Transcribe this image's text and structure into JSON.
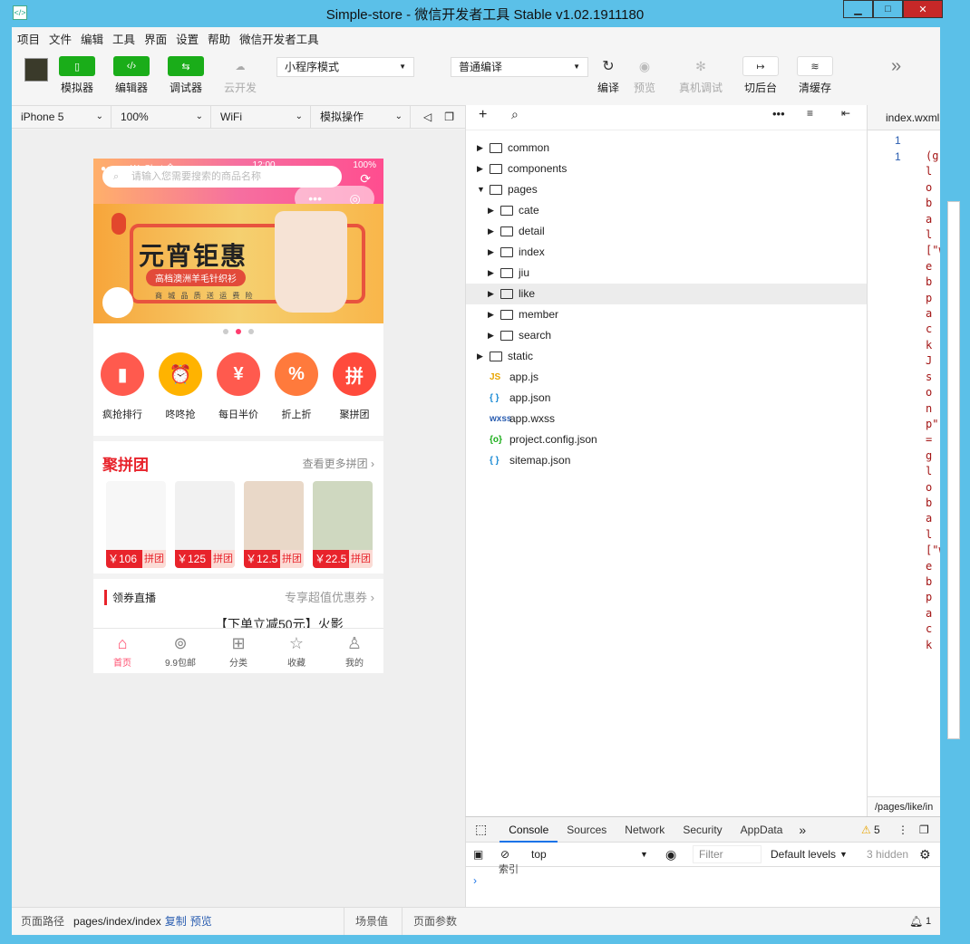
{
  "window": {
    "title": "Simple-store - 微信开发者工具 Stable v1.02.1911180",
    "icon": "devtools-logo-icon",
    "min": "▁",
    "max": "□",
    "close": "✕"
  },
  "menu": [
    "项目",
    "文件",
    "编辑",
    "工具",
    "界面",
    "设置",
    "帮助",
    "微信开发者工具"
  ],
  "toolbar": {
    "simulator": "模拟器",
    "editor": "编辑器",
    "debugger": "调试器",
    "cloud": "云开发",
    "mode": "小程序模式",
    "compile_mode": "普通编译",
    "compile": "编译",
    "preview": "预览",
    "real_debug": "真机调试",
    "background": "切后台",
    "clear_cache": "清缓存",
    "more": "»"
  },
  "subbar": {
    "device": "iPhone 5",
    "zoom": "100%",
    "network": "WiFi",
    "operation": "模拟操作"
  },
  "phone": {
    "status_left": "●●●●● WeChat 令",
    "status_time": "12:00",
    "status_right": "100%",
    "search_placeholder": "请输入您需要搜索的商品名称",
    "banner_title": "元宵钜惠",
    "banner_sub": "高档澳洲羊毛针织衫",
    "banner_sub2": "商 城 品 质   送 运 费 险",
    "categories": [
      {
        "name": "疯抢排行",
        "color": "#ff5a4e",
        "icon": "bar-chart-icon",
        "glyph": "▮"
      },
      {
        "name": "咚咚抢",
        "color": "#ffb300",
        "icon": "alarm-clock-icon",
        "glyph": "⏰"
      },
      {
        "name": "每日半价",
        "color": "#ff5a4e",
        "icon": "calendar-icon",
        "glyph": "¥"
      },
      {
        "name": "折上折",
        "color": "#ff7a3c",
        "icon": "discount-tag-icon",
        "glyph": "%"
      },
      {
        "name": "聚拼团",
        "color": "#ff4a3c",
        "icon": "group-buy-icon",
        "glyph": "拼"
      }
    ],
    "group": {
      "title": "聚拼团",
      "more": "查看更多拼团 ›",
      "items": [
        {
          "price": "￥106",
          "tag": "拼团",
          "color": "#f7f7f7"
        },
        {
          "price": "￥125",
          "tag": "拼团",
          "color": "#f1f1f1"
        },
        {
          "price": "￥12.5",
          "tag": "拼团",
          "color": "#e9d8c8"
        },
        {
          "price": "￥22.5",
          "tag": "拼团",
          "color": "#cfd8c0"
        }
      ]
    },
    "coupon": {
      "title": "领券直播",
      "more": "专享超值优惠券 ›",
      "ad": "【下单立减50元】火影"
    },
    "tabs": [
      {
        "label": "首页",
        "icon": "home-icon",
        "glyph": "⌂",
        "active": true
      },
      {
        "label": "9.9包邮",
        "icon": "coin-icon",
        "glyph": "⊚",
        "active": false
      },
      {
        "label": "分类",
        "icon": "category-grid-icon",
        "glyph": "⊞",
        "active": false
      },
      {
        "label": "收藏",
        "icon": "star-icon",
        "glyph": "☆",
        "active": false
      },
      {
        "label": "我的",
        "icon": "user-icon",
        "glyph": "♙",
        "active": false
      }
    ]
  },
  "tree": [
    {
      "type": "folder",
      "name": "common",
      "depth": 0,
      "open": false
    },
    {
      "type": "folder",
      "name": "components",
      "depth": 0,
      "open": false
    },
    {
      "type": "folder",
      "name": "pages",
      "depth": 0,
      "open": true
    },
    {
      "type": "folder",
      "name": "cate",
      "depth": 1,
      "open": false
    },
    {
      "type": "folder",
      "name": "detail",
      "depth": 1,
      "open": false
    },
    {
      "type": "folder",
      "name": "index",
      "depth": 1,
      "open": false
    },
    {
      "type": "folder",
      "name": "jiu",
      "depth": 1,
      "open": false
    },
    {
      "type": "folder",
      "name": "like",
      "depth": 1,
      "open": false,
      "selected": true
    },
    {
      "type": "folder",
      "name": "member",
      "depth": 1,
      "open": false
    },
    {
      "type": "folder",
      "name": "search",
      "depth": 1,
      "open": false
    },
    {
      "type": "folder",
      "name": "static",
      "depth": 0,
      "open": false
    },
    {
      "type": "file",
      "name": "app.js",
      "badge": "JS",
      "color": "#e8a400"
    },
    {
      "type": "file",
      "name": "app.json",
      "badge": "{ }",
      "color": "#1a8ad4"
    },
    {
      "type": "file",
      "name": "app.wxss",
      "badge": "wxss",
      "color": "#2a5db0"
    },
    {
      "type": "file",
      "name": "project.config.json",
      "badge": "{o}",
      "color": "#1aad19"
    },
    {
      "type": "file",
      "name": "sitemap.json",
      "badge": "{ }",
      "color": "#1a8ad4"
    }
  ],
  "editor": {
    "tab": "index.wxml",
    "line1": "1",
    "line2": "1",
    "code": "(global[\"webpackJsonp\"]=global[\"webpack",
    "path": "/pages/like/in"
  },
  "devtools": {
    "tabs": [
      "Console",
      "Sources",
      "Network",
      "Security",
      "AppData"
    ],
    "more": "»",
    "warnings": "5",
    "context": "top",
    "filter_placeholder": "Filter",
    "levels": "Default levels",
    "hidden": "3 hidden",
    "prompt": "›",
    "log_partial": "索引"
  },
  "status": {
    "path_label": "页面路径",
    "path": "pages/index/index",
    "copy": "复制",
    "preview": "预览",
    "scene": "场景值",
    "params": "页面参数",
    "notif": "1"
  }
}
